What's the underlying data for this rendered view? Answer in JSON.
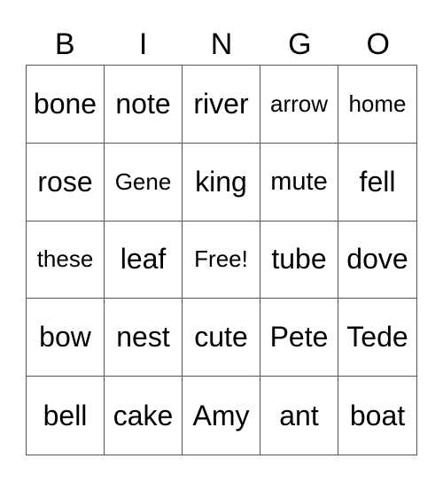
{
  "card": {
    "header": [
      "B",
      "I",
      "N",
      "G",
      "O"
    ],
    "rows": [
      [
        "bone",
        "note",
        "river",
        "arrow",
        "home"
      ],
      [
        "rose",
        "Gene",
        "king",
        "mute",
        "fell"
      ],
      [
        "these",
        "leaf",
        "Free!",
        "tube",
        "dove"
      ],
      [
        "bow",
        "nest",
        "cute",
        "Pete",
        "Tede"
      ],
      [
        "bell",
        "cake",
        "Amy",
        "ant",
        "boat"
      ]
    ]
  }
}
